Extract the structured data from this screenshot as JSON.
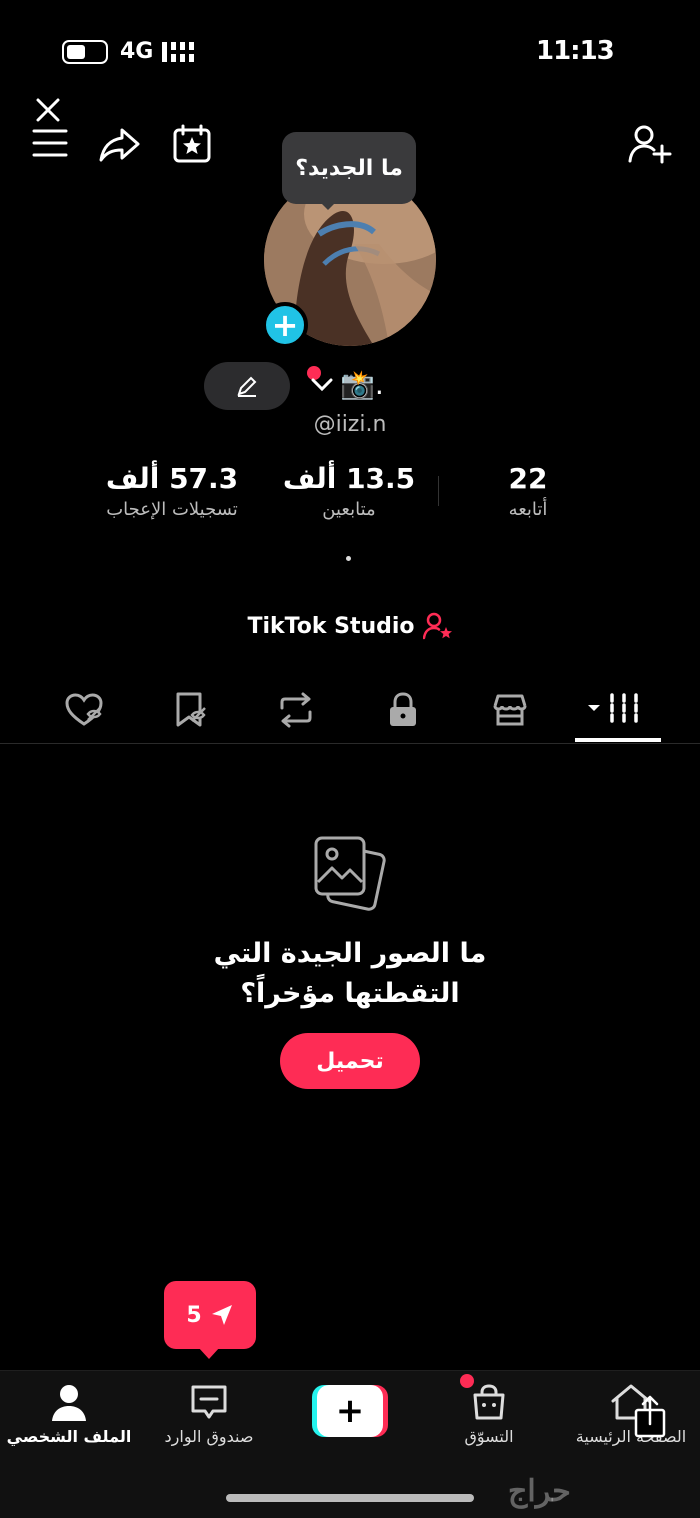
{
  "status_bar": {
    "time": "11:13",
    "network": "4G"
  },
  "tooltip": {
    "text": "ما الجديد؟"
  },
  "profile": {
    "display_name": "📸.",
    "handle": "@iizi.n"
  },
  "stats": [
    {
      "value": "57.3 ألف",
      "label": "تسجيلات الإعجاب"
    },
    {
      "value": "13.5 ألف",
      "label": "متابعين"
    },
    {
      "value": "22",
      "label": "أتابعه"
    }
  ],
  "studio": {
    "label": "TikTok Studio"
  },
  "tabs": [
    "liked-hidden",
    "favorites-hidden",
    "reposts",
    "private",
    "shop",
    "grid"
  ],
  "empty_state": {
    "line1": "ما الصور الجيدة التي",
    "line2": "التقطتها مؤخراً؟",
    "button": "تحميل"
  },
  "inbox_badge": {
    "count": "5"
  },
  "bottom_nav": {
    "profile": "الملف الشخصي",
    "inbox": "صندوق الوارد",
    "shop": "التسوّق",
    "home": "الصفحة الرئيسية"
  },
  "watermark": "حراج",
  "colors": {
    "accent": "#fe2c55",
    "cyan": "#25f4ee",
    "background": "#000000"
  }
}
